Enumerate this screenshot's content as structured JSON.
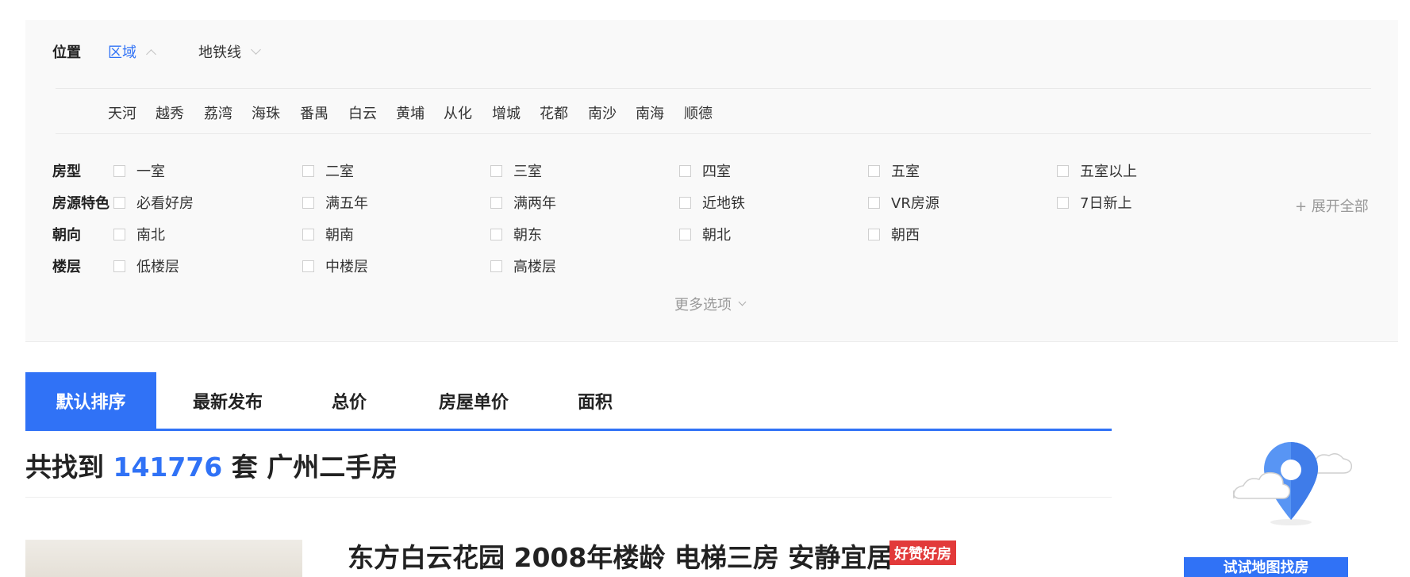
{
  "filters": {
    "location": {
      "label": "位置",
      "tabs": [
        {
          "label": "区域",
          "active": true,
          "icon": "chevron-up-icon"
        },
        {
          "label": "地铁线",
          "active": false,
          "icon": "chevron-down-icon"
        }
      ],
      "districts": [
        "天河",
        "越秀",
        "荔湾",
        "海珠",
        "番禺",
        "白云",
        "黄埔",
        "从化",
        "增城",
        "花都",
        "南沙",
        "南海",
        "顺德"
      ]
    },
    "layout": {
      "label": "房型",
      "options": [
        "一室",
        "二室",
        "三室",
        "四室",
        "五室",
        "五室以上"
      ]
    },
    "features": {
      "label": "房源特色",
      "options": [
        "必看好房",
        "满五年",
        "满两年",
        "近地铁",
        "VR房源",
        "7日新上"
      ],
      "expand_label": "+ 展开全部"
    },
    "orientation": {
      "label": "朝向",
      "options": [
        "南北",
        "朝南",
        "朝东",
        "朝北",
        "朝西"
      ]
    },
    "floor": {
      "label": "楼层",
      "options": [
        "低楼层",
        "中楼层",
        "高楼层"
      ]
    },
    "more_label": "更多选项"
  },
  "sort": {
    "tabs": [
      "默认排序",
      "最新发布",
      "总价",
      "房屋单价",
      "面积"
    ],
    "active_index": 0
  },
  "results": {
    "prefix": "共找到",
    "count": "141776",
    "suffix": "套 广州二手房"
  },
  "listing": {
    "title": "东方白云花园 2008年楼龄 电梯三房 安静宜居",
    "badge": "好赞好房"
  },
  "map_promo": {
    "button_label": "试试地图找房",
    "icon": "map-pin-icon"
  },
  "colors": {
    "accent": "#3072f6",
    "badge_red": "#e23a3a",
    "panel_bg": "#f9f9f9"
  }
}
